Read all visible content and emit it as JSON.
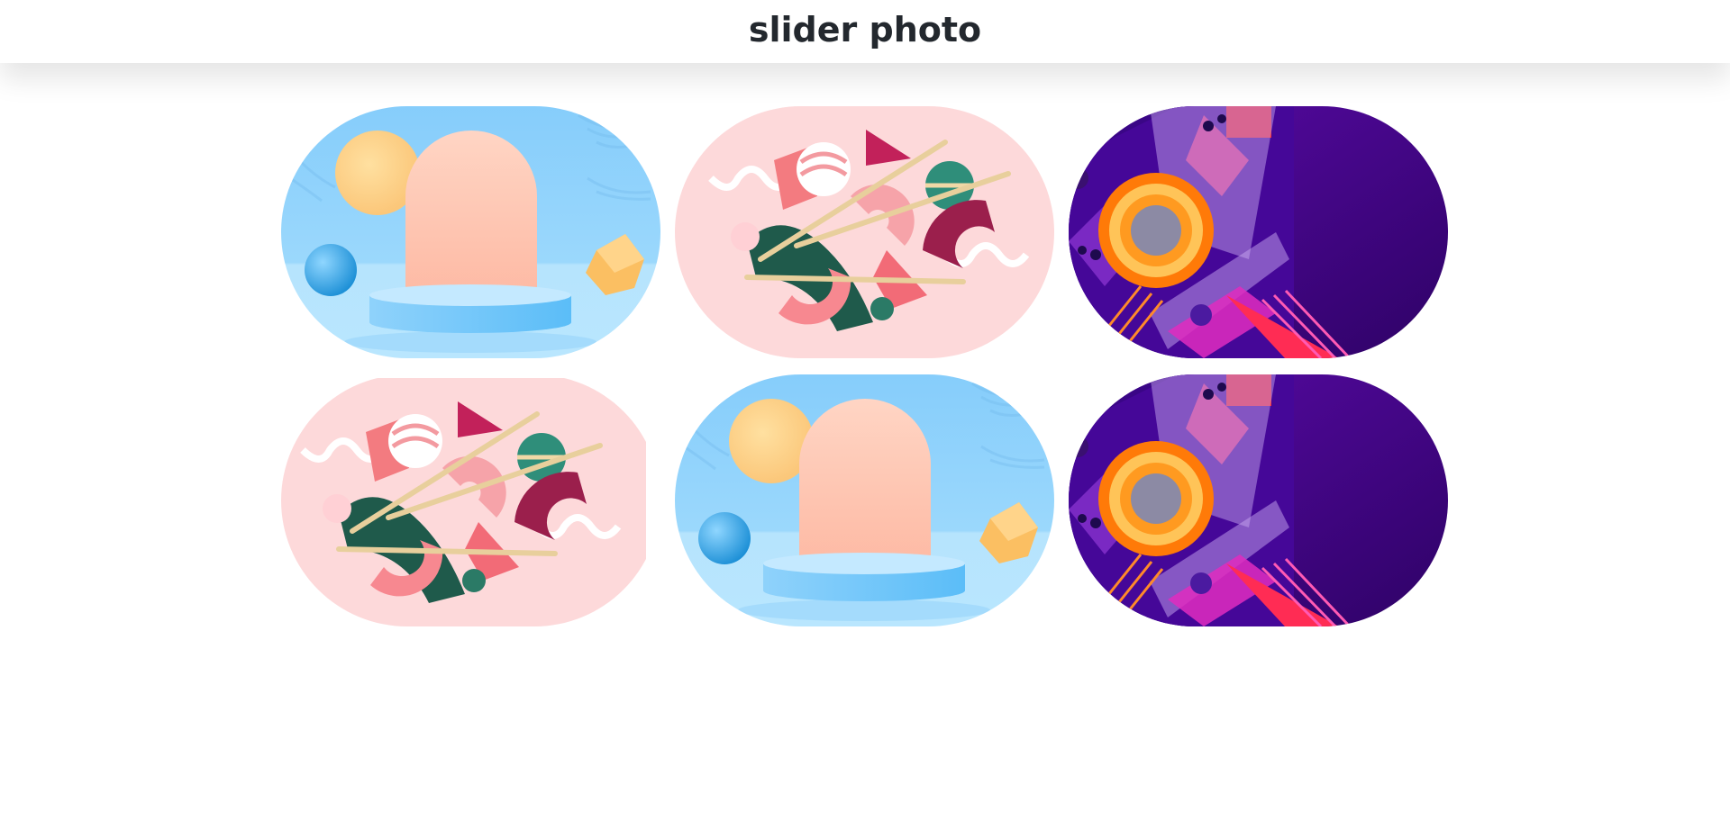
{
  "header": {
    "title": "slider photo"
  },
  "gallery": {
    "items": [
      {
        "theme": "podium-sky",
        "icon": "podium-scene-image"
      },
      {
        "theme": "candy-pink",
        "icon": "abstract-candy-image"
      },
      {
        "theme": "geo-purple",
        "icon": "geometric-purple-image"
      },
      {
        "theme": "candy-pink",
        "icon": "abstract-candy-image"
      },
      {
        "theme": "podium-sky",
        "icon": "podium-scene-image"
      },
      {
        "theme": "geo-purple",
        "icon": "geometric-purple-image"
      }
    ]
  },
  "colors": {
    "sky": "#8fd0fb",
    "pink": "#fdd9da",
    "purple": "#4a0795",
    "title": "#23282e"
  }
}
